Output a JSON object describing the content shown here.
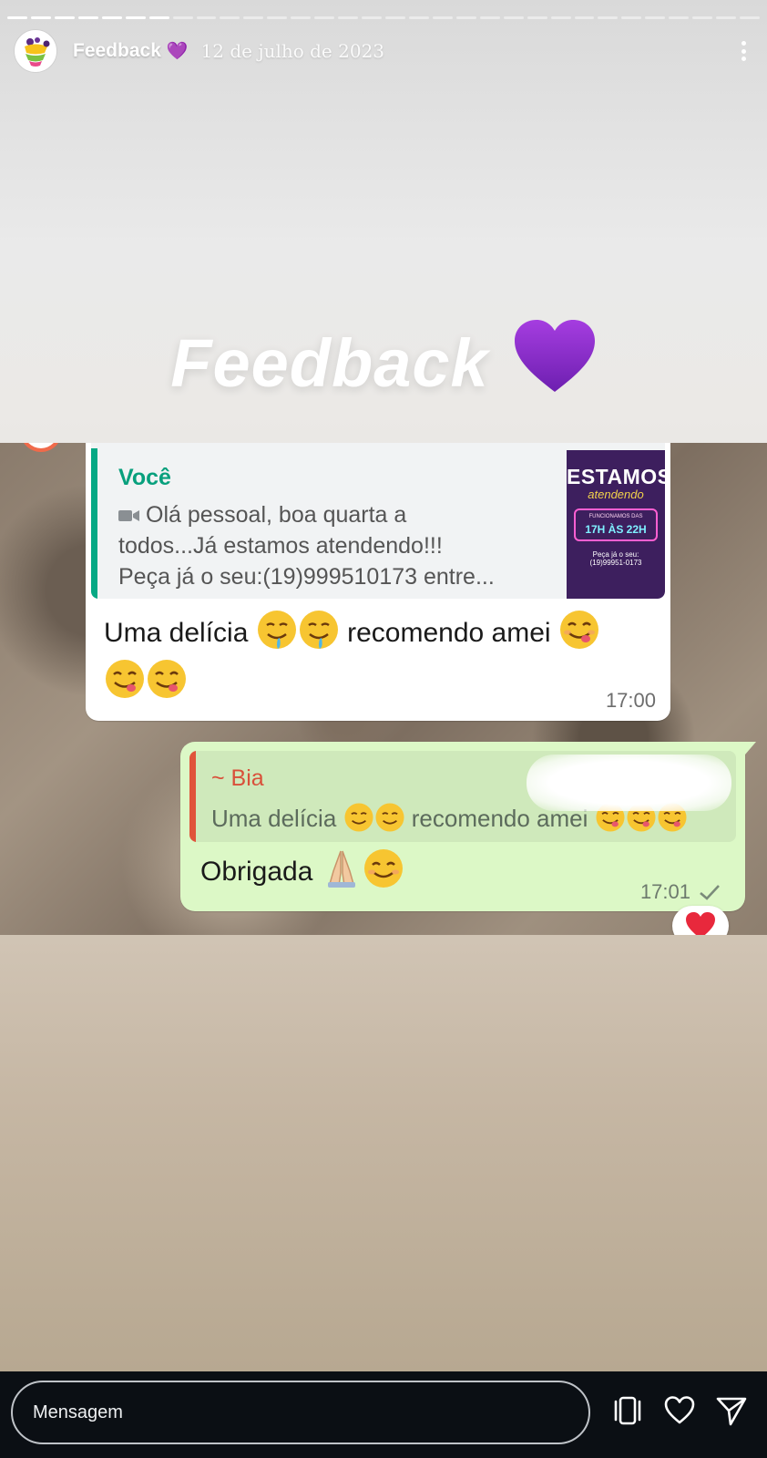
{
  "story": {
    "user_name": "Feedback",
    "title_emoji": "💜",
    "date": "12 de julho de 2023",
    "progress_segments": 32,
    "progress_done": 7,
    "overlay_text": "Feedback"
  },
  "chat": {
    "incoming": {
      "quote_name": "Você",
      "quote_line1": "Olá pessoal, boa quarta a",
      "quote_line2": "todos...Já estamos atendendo!!!",
      "quote_line3": "Peça já o seu:(19)999510173 entre...",
      "thumb_title": "ESTAMOS",
      "thumb_subtitle": "atendendo",
      "thumb_hours_label": "FUNCIONAMOS DAS",
      "thumb_hours": "17H ÀS 22H",
      "thumb_order": "Peça já o seu:",
      "thumb_phone": "(19)99951-0173",
      "text_a": "Uma delícia",
      "text_b": "recomendo amei",
      "time": "17:00"
    },
    "outgoing": {
      "quote_name": "~ Bia",
      "quote_text_a": "Uma delícia",
      "quote_text_b": "recomendo amei",
      "text": "Obrigada",
      "time": "17:01"
    },
    "reaction": "heart"
  },
  "bottom": {
    "input_placeholder": "Mensagem"
  },
  "colors": {
    "accent_purple": "#8b2fc9",
    "whatsapp_green": "#08a07d",
    "outgoing_bubble": "#dcf8c6",
    "quote_red": "#d9503a"
  }
}
